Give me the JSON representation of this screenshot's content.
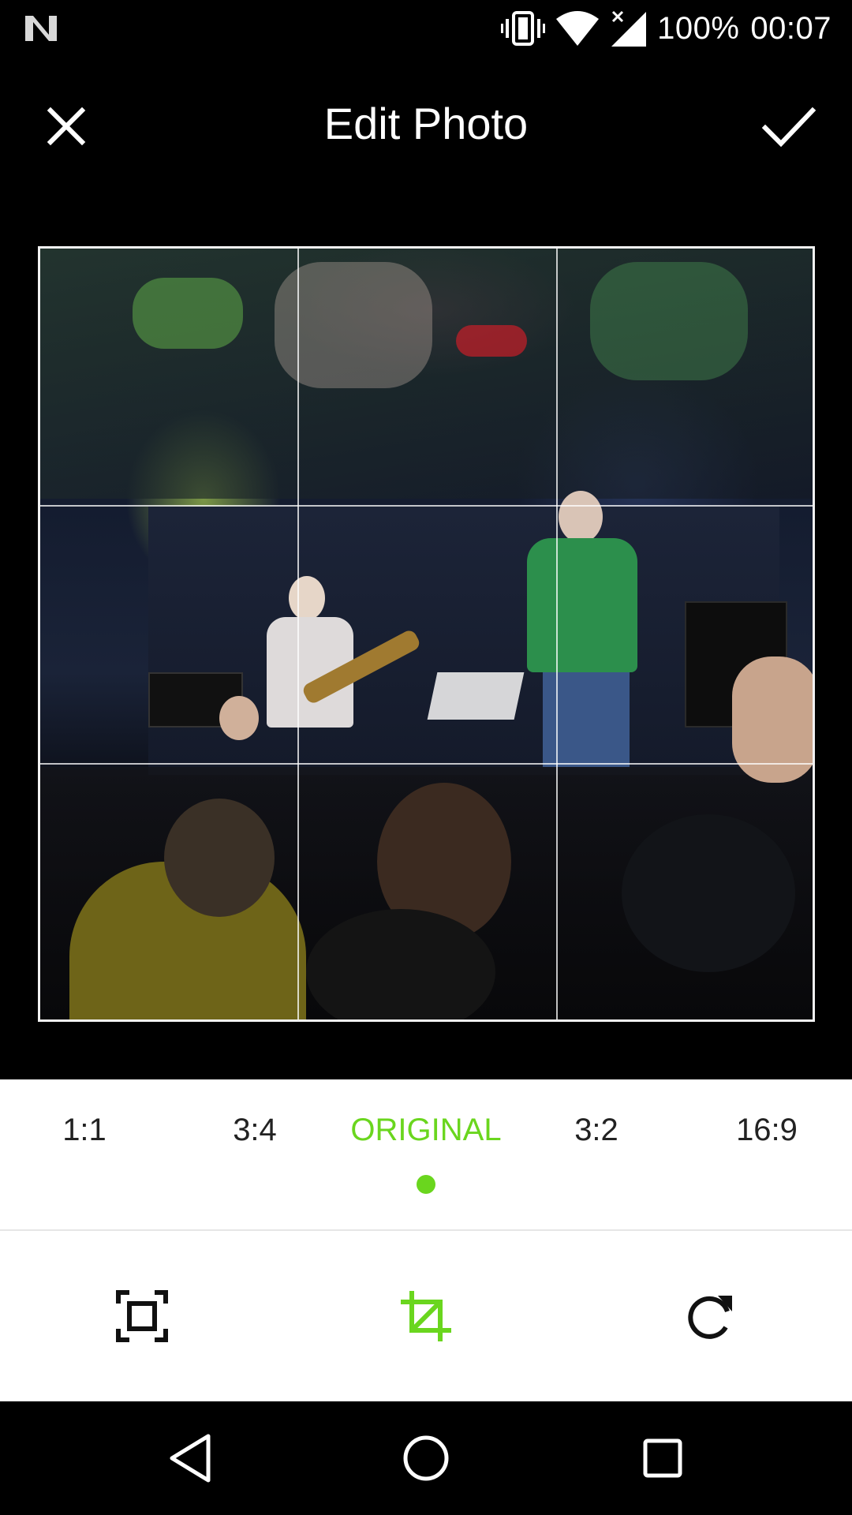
{
  "status_bar": {
    "battery": "100%",
    "time": "00:07",
    "icons": [
      "notification-n-icon",
      "vibrate-icon",
      "wifi-icon",
      "cellular-no-data-icon"
    ]
  },
  "toolbar": {
    "title": "Edit Photo",
    "close_icon": "close-icon",
    "confirm_icon": "check-icon"
  },
  "photo": {
    "description_icon": "concert-photo"
  },
  "aspect_ratios": {
    "items": [
      {
        "label": "1:1",
        "active": false
      },
      {
        "label": "3:4",
        "active": false
      },
      {
        "label": "ORIGINAL",
        "active": true
      },
      {
        "label": "3:2",
        "active": false
      },
      {
        "label": "16:9",
        "active": false
      }
    ],
    "selected": "ORIGINAL"
  },
  "tools": [
    {
      "icon": "fit-frame-icon",
      "active": false
    },
    {
      "icon": "crop-icon",
      "active": true
    },
    {
      "icon": "rotate-icon",
      "active": false
    }
  ],
  "colors": {
    "accent": "#6ad61e",
    "background": "#000000",
    "panel": "#ffffff",
    "text_dark": "#222222"
  },
  "nav_bar": {
    "icons": [
      "back-icon",
      "home-icon",
      "recents-icon"
    ]
  }
}
